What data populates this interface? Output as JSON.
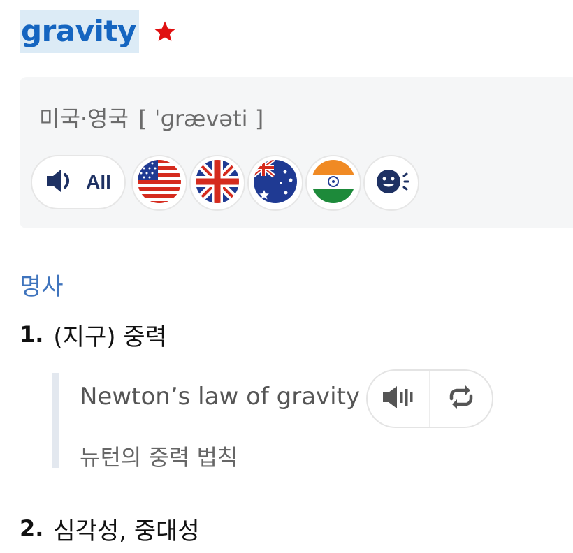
{
  "entry": {
    "headword": "gravity",
    "star_icon": "star-icon",
    "star_color": "#e01010",
    "headword_color": "#1565c0",
    "highlight_color": "#dcebf6"
  },
  "pronunciation": {
    "region": "미국·영국",
    "ipa": "[ ˈɡrævəti ]",
    "buttons": {
      "all_label": "All",
      "all_icon": "speaker-icon",
      "us_icon": "us-flag-icon",
      "uk_icon": "uk-flag-icon",
      "au_icon": "australia-flag-icon",
      "in_icon": "india-flag-icon",
      "fun_icon": "smiley-speaker-icon"
    }
  },
  "part_of_speech": "명사",
  "senses": [
    {
      "number": "1.",
      "definition": "(지구) 중력"
    },
    {
      "number": "2.",
      "definition": "심각성, 중대성"
    }
  ],
  "example": {
    "english": "Newton’s law of gravity",
    "korean": "뉴턴의 중력 법칙",
    "play_icon": "speaker-bars-icon",
    "repeat_icon": "repeat-icon"
  }
}
